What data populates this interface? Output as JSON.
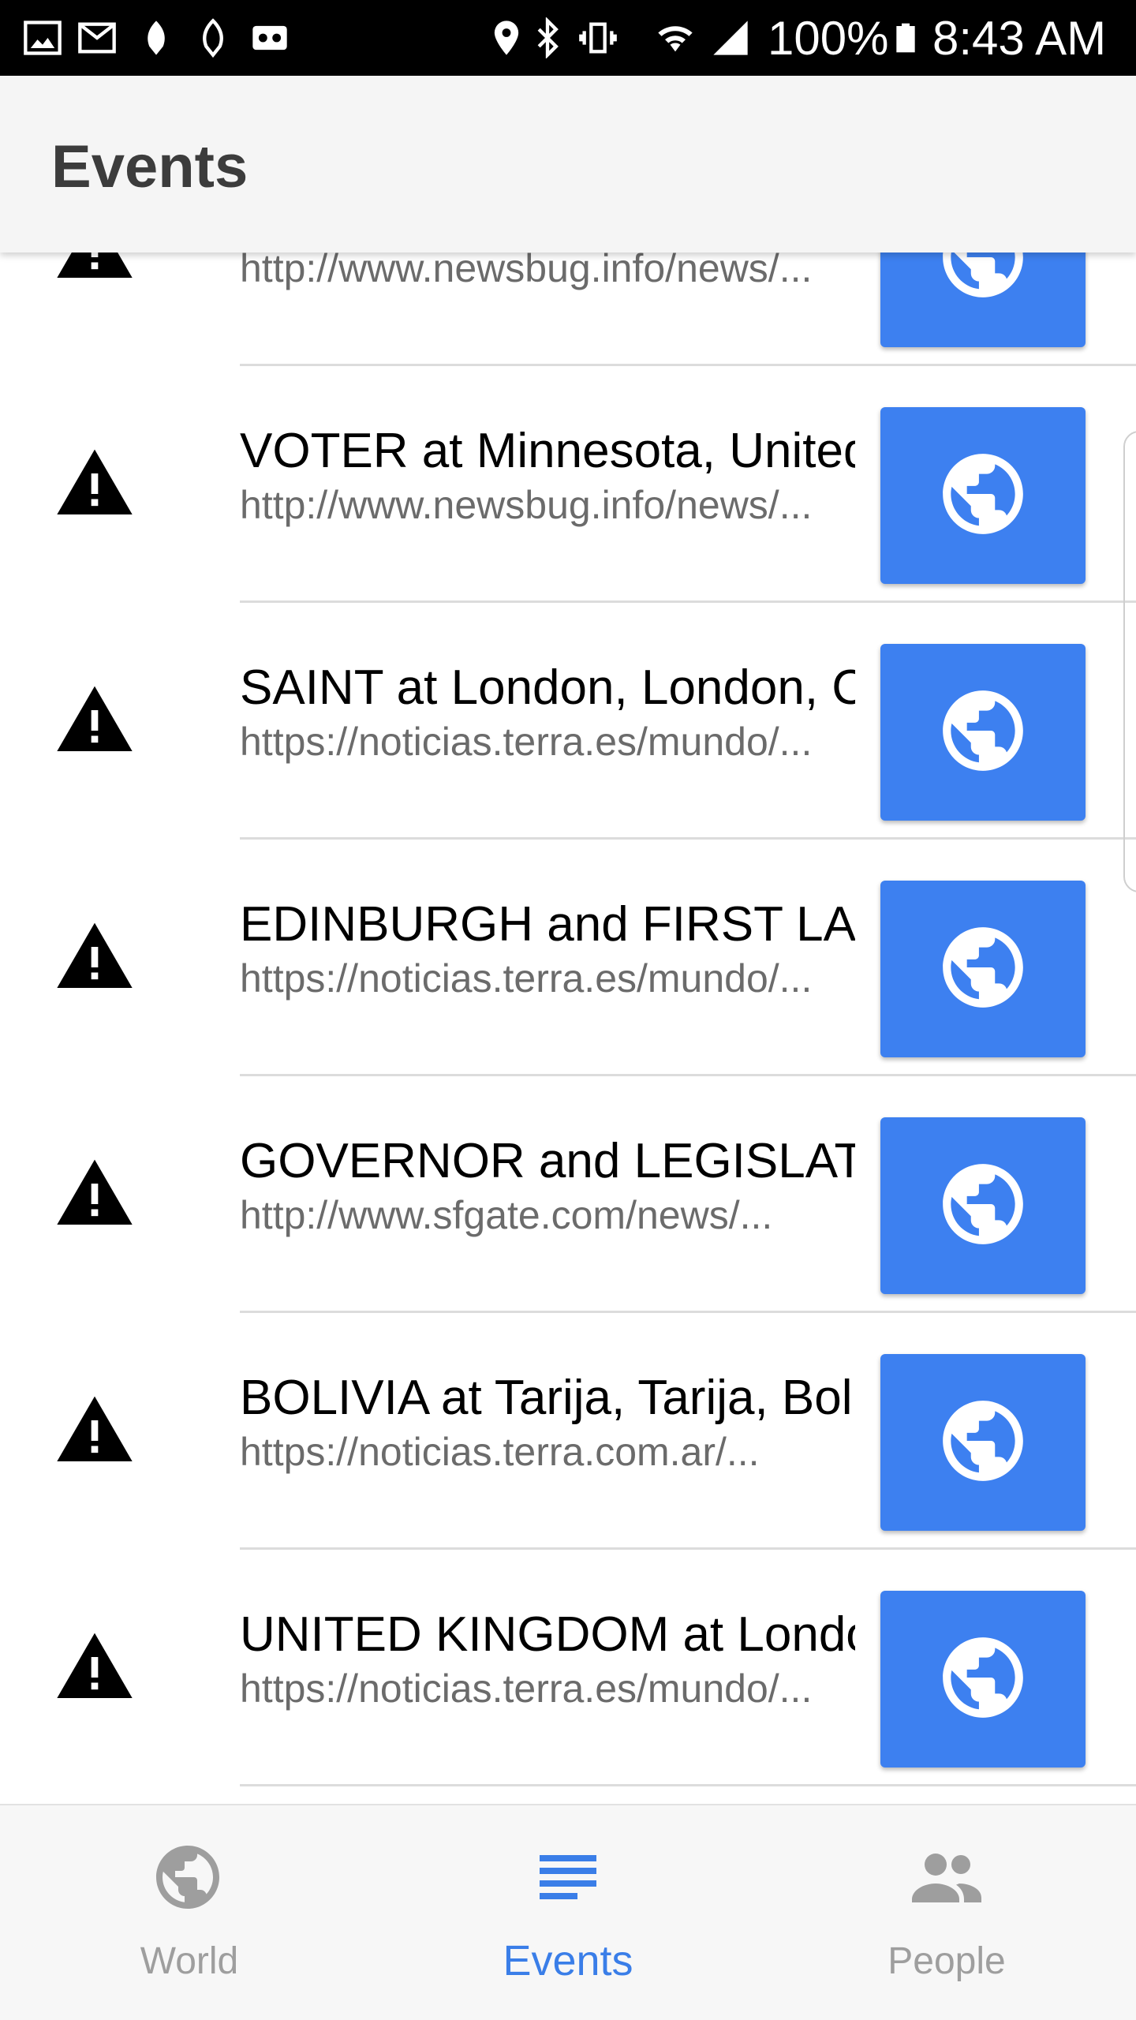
{
  "status_bar": {
    "battery_text": "100%",
    "time": "8:43 AM"
  },
  "app_bar": {
    "title": "Events"
  },
  "colors": {
    "accent": "#3d80f0",
    "nav_active": "#3a7ee8",
    "nav_inactive": "#9e9e9e",
    "status_bar": "#000000"
  },
  "events": [
    {
      "title": "",
      "url": "http://www.newsbug.info/news/..."
    },
    {
      "title": "VOTER at Minnesota, United",
      "url": "http://www.newsbug.info/news/..."
    },
    {
      "title": "SAINT at London, London, C",
      "url": "https://noticias.terra.es/mundo/..."
    },
    {
      "title": "EDINBURGH and FIRST LAD",
      "url": "https://noticias.terra.es/mundo/..."
    },
    {
      "title": "GOVERNOR and LEGISLATU",
      "url": "http://www.sfgate.com/news/..."
    },
    {
      "title": "BOLIVIA at Tarija, Tarija, Bol",
      "url": "https://noticias.terra.com.ar/..."
    },
    {
      "title": "UNITED KINGDOM at Londo",
      "url": "https://noticias.terra.es/mundo/..."
    }
  ],
  "bottom_nav": {
    "items": [
      {
        "label": "World",
        "icon": "globe-icon",
        "active": false
      },
      {
        "label": "Events",
        "icon": "list-icon",
        "active": true
      },
      {
        "label": "People",
        "icon": "people-icon",
        "active": false
      }
    ]
  }
}
